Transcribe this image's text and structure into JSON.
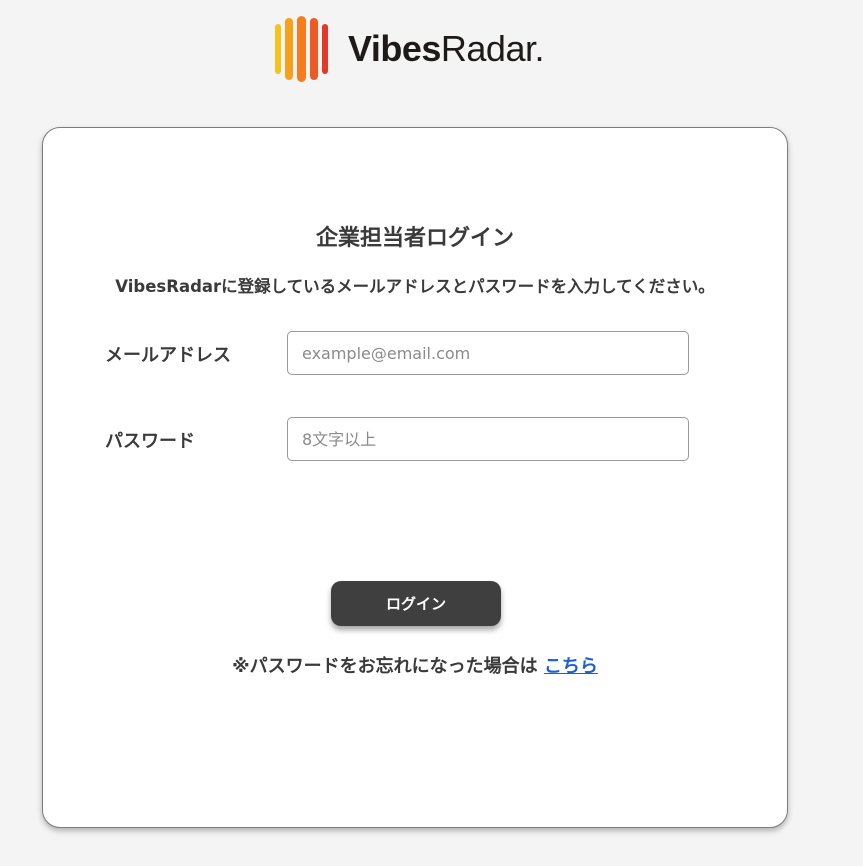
{
  "brand": {
    "name_bold": "Vibes",
    "name_light": "Radar.",
    "colors": [
      "#f6c21c",
      "#f7a01a",
      "#f57d1f",
      "#ef5a24",
      "#e23a2a"
    ]
  },
  "login": {
    "title": "企業担当者ログイン",
    "description": "VibesRadarに登録しているメールアドレスとパスワードを入力してください。",
    "email_label": "メールアドレス",
    "email_value": "",
    "email_placeholder": "example@email.com",
    "password_label": "パスワード",
    "password_value": "",
    "password_placeholder": "8文字以上",
    "submit_label": "ログイン",
    "forgot_text": "※パスワードをお忘れになった場合は",
    "forgot_link": "こちら"
  },
  "colors": {
    "page_bg": "#f4f4f4",
    "button_bg": "#3f3f3f",
    "link": "#1a5fd6"
  }
}
